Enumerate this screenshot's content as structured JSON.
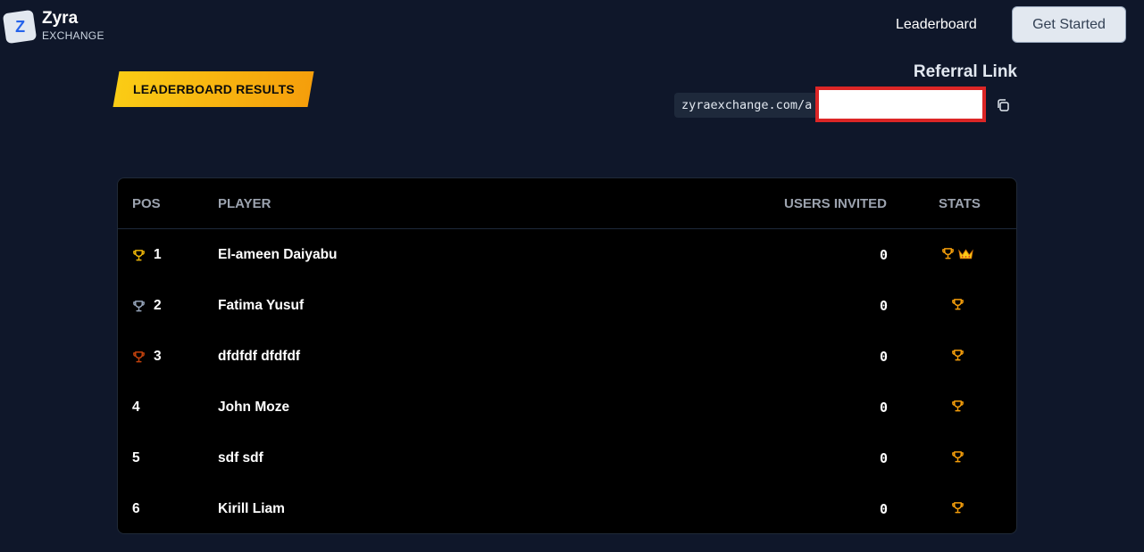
{
  "header": {
    "brand_letter": "Z",
    "brand_name": "Zyra",
    "brand_sub": "EXCHANGE",
    "nav_leaderboard": "Leaderboard",
    "get_started": "Get Started"
  },
  "banner": {
    "label": "LEADERBOARD RESULTS"
  },
  "referral": {
    "title": "Referral Link",
    "url_visible": "zyraexchange.com/a"
  },
  "table": {
    "headers": {
      "pos": "POS",
      "player": "PLAYER",
      "invited": "USERS INVITED",
      "stats": "STATS"
    },
    "rows": [
      {
        "pos": "1",
        "player": "El-ameen Daiyabu",
        "invited": "0",
        "medal": "gold",
        "crown": true
      },
      {
        "pos": "2",
        "player": "Fatima Yusuf",
        "invited": "0",
        "medal": "silver",
        "crown": false
      },
      {
        "pos": "3",
        "player": "dfdfdf dfdfdf",
        "invited": "0",
        "medal": "bronze",
        "crown": false
      },
      {
        "pos": "4",
        "player": "John Moze",
        "invited": "0",
        "medal": "",
        "crown": false
      },
      {
        "pos": "5",
        "player": "sdf sdf",
        "invited": "0",
        "medal": "",
        "crown": false
      },
      {
        "pos": "6",
        "player": "Kirill Liam",
        "invited": "0",
        "medal": "",
        "crown": false
      }
    ]
  },
  "colors": {
    "background": "#0f172a",
    "banner_start": "#facc15",
    "banner_end": "#f59e0b",
    "gold": "#eab308",
    "silver": "#94a3b8",
    "bronze": "#c2410c",
    "stats_trophy": "#f59e0b"
  }
}
